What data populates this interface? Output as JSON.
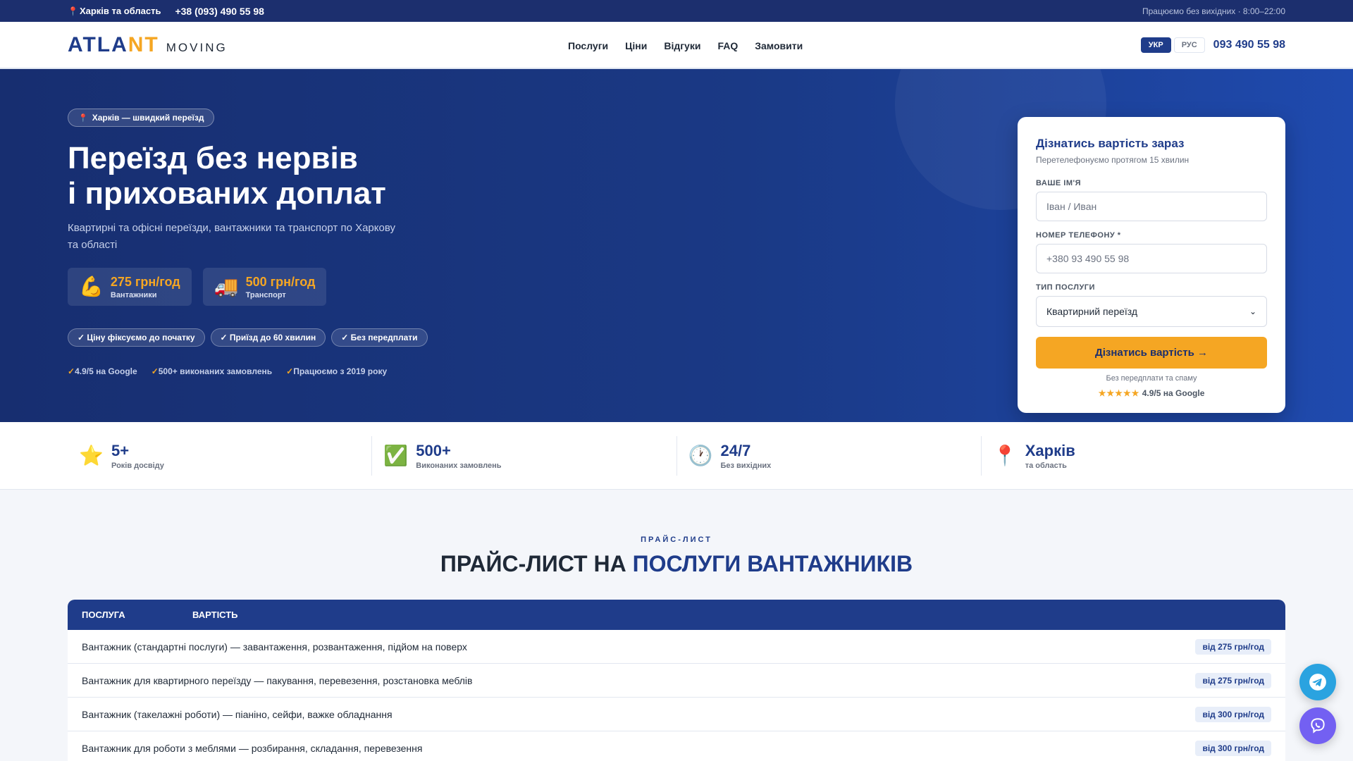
{
  "topbar": {
    "location": "Харків та область",
    "phone": "+38 (093) 490 55 98",
    "hours": "Працюємо без вихідних · 8:00–22:00"
  },
  "header": {
    "logo_left": "ATLA",
    "logo_accent": "NT",
    "logo_sub": "MOVING",
    "nav": [
      "Послуги",
      "Ціни",
      "Відгуки",
      "FAQ",
      "Замовити"
    ],
    "lang_ukr": "УКР",
    "lang_rus": "РУС",
    "phone": "093 490 55 98"
  },
  "hero": {
    "badge": "Харків — швидкий переїзд",
    "title_line1": "Переїзд без нервів",
    "title_line2": "і прихованих доплат",
    "subtitle": "Квартирні та офісні переїзди, вантажники та транспорт по Харкову та області",
    "cards": [
      {
        "emoji": "💪",
        "amount": "275 грн/год",
        "label": "Вантажники"
      },
      {
        "emoji": "🚚",
        "amount": "500 грн/год",
        "label": "Транспорт"
      }
    ],
    "chips": [
      "✓ Ціну фіксуємо до початку",
      "✓ Приїзд до 60 хвилин",
      "✓ Без передплати"
    ],
    "trust": [
      "4.9/5 на Google",
      "500+ виконаних замовлень",
      "Працюємо з 2019 року"
    ]
  },
  "form": {
    "title": "Дізнатись вартість зараз",
    "subtitle": "Перетелефонуємо протягом 15 хвилин",
    "name_label": "ВАШЕ ІМ'Я",
    "name_placeholder": "Іван / Иван",
    "phone_label": "НОМЕР ТЕЛЕФОНУ *",
    "phone_placeholder": "+380 93 490 55 98",
    "service_label": "ТИП ПОСЛУГИ",
    "service_value": "Квартирний переїзд",
    "submit": "Дізнатись вартість →",
    "note": "Без передплати та спаму",
    "stars": "★★★★★",
    "rating": "4.9/5 на Google"
  },
  "stats": [
    {
      "icon": "⭐",
      "value": "5+",
      "label": "Років досвіду"
    },
    {
      "icon": "✅",
      "value": "500+",
      "label": "Виконаних замовлень"
    },
    {
      "icon": "🕐",
      "value": "24/7",
      "label": "Без вихідних"
    },
    {
      "icon": "📍",
      "value": "Харків",
      "label": "та область"
    }
  ],
  "pricing": {
    "eyebrow": "ПРАЙС-ЛИСТ",
    "title_plain": "ПРАЙС-ЛИСТ НА ",
    "title_highlight": "ПОСЛУГИ ВАНТАЖНИКІВ",
    "col_service": "ПОСЛУГА",
    "col_price": "ВАРТІСТЬ",
    "rows": [
      {
        "service": "Вантажник (стандартні послуги) — завантаження, розвантаження, підйом на поверх",
        "price": "від 275 грн/год"
      },
      {
        "service": "Вантажник для квартирного переїзду — пакування, перевезення, розстановка меблів",
        "price": "від 275 грн/год"
      },
      {
        "service": "Вантажник (такелажні роботи) — піаніно, сейфи, важке обладнання",
        "price": "від 300 грн/год"
      },
      {
        "service": "Вантажник для роботи з меблями — розбирання, складання, перевезення",
        "price": "від 300 грн/год"
      }
    ]
  },
  "colors": {
    "primary": "#1f3c8a",
    "accent": "#f5a623",
    "topbar": "#1c2f6e",
    "telegram": "#2aa3e0",
    "viber": "#7360f2"
  }
}
